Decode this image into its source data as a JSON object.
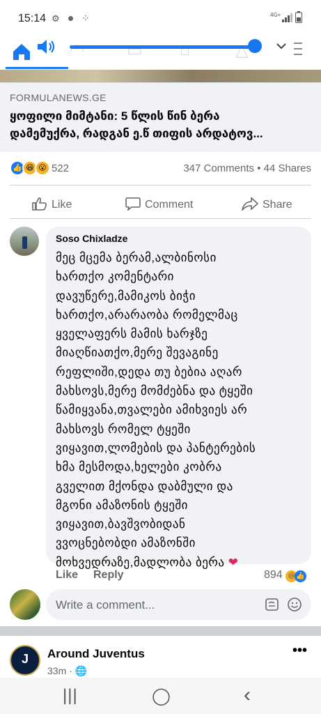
{
  "status_bar": {
    "time": "15:14",
    "left_icons": [
      "gear-icon",
      "notification-dot-icon",
      "grid-icon"
    ],
    "network": "4G+",
    "right_icons": [
      "signal-icon",
      "battery-icon"
    ]
  },
  "media_overlay": {
    "icons": [
      "home-icon",
      "volume-icon",
      "chevron-down-icon",
      "menu-icon"
    ],
    "volume_level": 0.96
  },
  "link_preview": {
    "domain": "FORMULANEWS.GE",
    "title": "ყოფილი მიმტანი: 5 წლის წინ ბერა\nდამემუქრა, რადგან ე.წ თიფის არდატოვ..."
  },
  "post_stats": {
    "reactions": [
      "like",
      "haha",
      "wow"
    ],
    "reaction_count": "522",
    "comments_shares": "347 Comments • 44 Shares"
  },
  "post_actions": {
    "like": "Like",
    "comment": "Comment",
    "share": "Share"
  },
  "comment": {
    "author": "Soso Chixladze",
    "lines": [
      "მეც მცემა ბერამ,ალბინოსი",
      "ხართქო კომენტარი",
      "დავუწერე,მამიკოს ბიჭი",
      "ხართქო,არარაობა რომელმაც",
      "ყველაფერს მამის ხარჯზე",
      "მიაღწიათქო,მერე შევაგინე",
      "რეფლიში,დედა თუ ბებია აღარ",
      "მახსოვს,მერე მომძებნა და ტყეში",
      "წამიყვანა,თვალები ამიხვიეს არ",
      "მახსოვს რომელ ტყეში",
      "ვიყავით,ლომების და პანტერების",
      "ხმა მესმოდა,ხელები კობრა",
      "გველით მქონდა დაბმული და",
      "მგონი ამაზონის ტყეში",
      "ვიყავით,ბავშვობიდან",
      "ვვოცნებობდი ამაზონში",
      "მოხვედრაზე,მადლობა ბერა"
    ],
    "end_emoji": "❤",
    "like": "Like",
    "reply": "Reply",
    "reaction_count": "894"
  },
  "write_comment": {
    "placeholder": "Write a comment..."
  },
  "next_post": {
    "page_name": "Around Juventus",
    "time": "33m",
    "avatar_letter": "J",
    "more": "•••"
  },
  "system_nav": {
    "recents": "|||",
    "home": "◯",
    "back": "‹"
  }
}
